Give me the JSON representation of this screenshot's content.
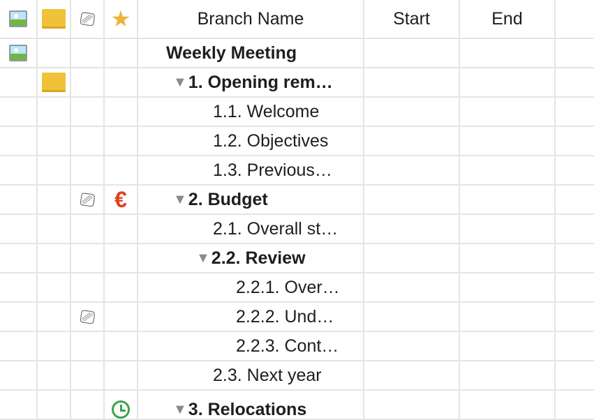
{
  "header": {
    "image_col_icon": "image-icon",
    "note_col_icon": "note-icon",
    "attachment_col_icon": "paperclip-icon",
    "marker_col_icon": "star-icon",
    "branch_name": "Branch Name",
    "start": "Start",
    "end": "End"
  },
  "rows": [
    {
      "name": "Weekly Meeting",
      "bold": true,
      "expanded": null,
      "icons": [
        "image-icon"
      ]
    },
    {
      "name": "1. Opening rem…",
      "bold": true,
      "expanded": true,
      "icons": [
        "note-icon"
      ]
    },
    {
      "name": "1.1. Welcome",
      "bold": false
    },
    {
      "name": "1.2. Objectives",
      "bold": false
    },
    {
      "name": "1.3. Previous…",
      "bold": false
    },
    {
      "name": "2. Budget",
      "bold": true,
      "expanded": true,
      "icons": [
        "paperclip-icon",
        "euro-icon"
      ]
    },
    {
      "name": "2.1. Overall st…",
      "bold": false
    },
    {
      "name": "2.2. Review",
      "bold": true,
      "expanded": true
    },
    {
      "name": "2.2.1. Over…",
      "bold": false
    },
    {
      "name": "2.2.2. Und…",
      "bold": false,
      "icons": [
        "paperclip-icon"
      ]
    },
    {
      "name": "2.2.3. Cont…",
      "bold": false
    },
    {
      "name": "2.3. Next year",
      "bold": false
    },
    {
      "name": "3. Relocations",
      "bold": true,
      "expanded": true,
      "icons": [
        "clock-icon"
      ]
    }
  ],
  "colors": {
    "grid_line": "#e4e4e4",
    "note": "#f0c23a",
    "star": "#f0b23c",
    "euro": "#e0401c",
    "clock": "#3aa34a"
  }
}
